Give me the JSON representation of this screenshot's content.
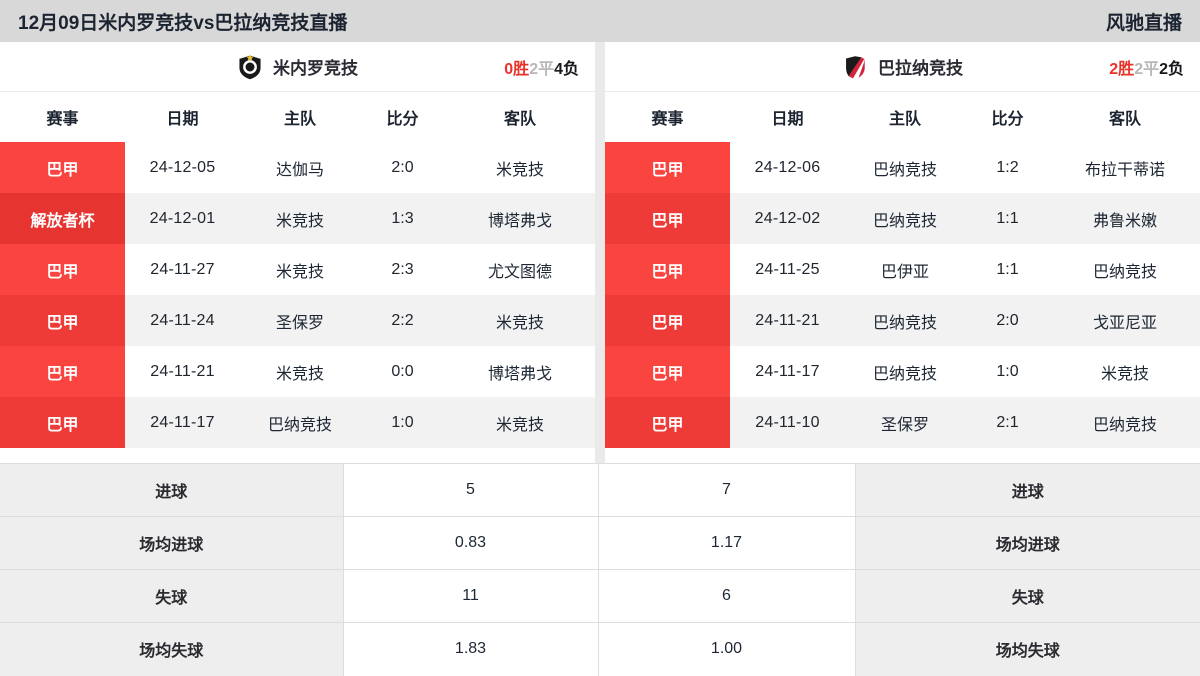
{
  "header": {
    "title": "12月09日米内罗竞技vs巴拉纳竞技直播",
    "brand": "风驰直播"
  },
  "left_panel": {
    "team": {
      "name": "米内罗竞技",
      "logo": "atletico-mineiro-shield-icon",
      "record": {
        "win": "0胜",
        "draw": "2平",
        "loss": "4负"
      }
    },
    "columns": [
      "赛事",
      "日期",
      "主队",
      "比分",
      "客队"
    ],
    "rows": [
      {
        "comp": "巴甲",
        "date": "24-12-05",
        "home": "达伽马",
        "score": "2:0",
        "away": "米竞技"
      },
      {
        "comp": "解放者杯",
        "date": "24-12-01",
        "home": "米竞技",
        "score": "1:3",
        "away": "博塔弗戈"
      },
      {
        "comp": "巴甲",
        "date": "24-11-27",
        "home": "米竞技",
        "score": "2:3",
        "away": "尤文图德"
      },
      {
        "comp": "巴甲",
        "date": "24-11-24",
        "home": "圣保罗",
        "score": "2:2",
        "away": "米竞技"
      },
      {
        "comp": "巴甲",
        "date": "24-11-21",
        "home": "米竞技",
        "score": "0:0",
        "away": "博塔弗戈"
      },
      {
        "comp": "巴甲",
        "date": "24-11-17",
        "home": "巴纳竞技",
        "score": "1:0",
        "away": "米竞技"
      }
    ]
  },
  "right_panel": {
    "team": {
      "name": "巴拉纳竞技",
      "logo": "athletico-paranaense-shield-icon",
      "record": {
        "win": "2胜",
        "draw": "2平",
        "loss": "2负"
      }
    },
    "columns": [
      "赛事",
      "日期",
      "主队",
      "比分",
      "客队"
    ],
    "rows": [
      {
        "comp": "巴甲",
        "date": "24-12-06",
        "home": "巴纳竞技",
        "score": "1:2",
        "away": "布拉干蒂诺"
      },
      {
        "comp": "巴甲",
        "date": "24-12-02",
        "home": "巴纳竞技",
        "score": "1:1",
        "away": "弗鲁米嫩"
      },
      {
        "comp": "巴甲",
        "date": "24-11-25",
        "home": "巴伊亚",
        "score": "1:1",
        "away": "巴纳竞技"
      },
      {
        "comp": "巴甲",
        "date": "24-11-21",
        "home": "巴纳竞技",
        "score": "2:0",
        "away": "戈亚尼亚"
      },
      {
        "comp": "巴甲",
        "date": "24-11-17",
        "home": "巴纳竞技",
        "score": "1:0",
        "away": "米竞技"
      },
      {
        "comp": "巴甲",
        "date": "24-11-10",
        "home": "圣保罗",
        "score": "2:1",
        "away": "巴纳竞技"
      }
    ]
  },
  "stats": {
    "rows": [
      {
        "label_left": "进球",
        "value_left": "5",
        "value_right": "7",
        "label_right": "进球"
      },
      {
        "label_left": "场均进球",
        "value_left": "0.83",
        "value_right": "1.17",
        "label_right": "场均进球"
      },
      {
        "label_left": "失球",
        "value_left": "11",
        "value_right": "6",
        "label_right": "失球"
      },
      {
        "label_left": "场均失球",
        "value_left": "1.83",
        "value_right": "1.00",
        "label_right": "场均失球"
      }
    ]
  },
  "colors": {
    "accent_red": "#f94440",
    "accent_red_dark": "#ee3b38",
    "header_gray": "#d8d8d8",
    "row_alt": "#f2f2f2",
    "stat_label_bg": "#eeeeee"
  }
}
